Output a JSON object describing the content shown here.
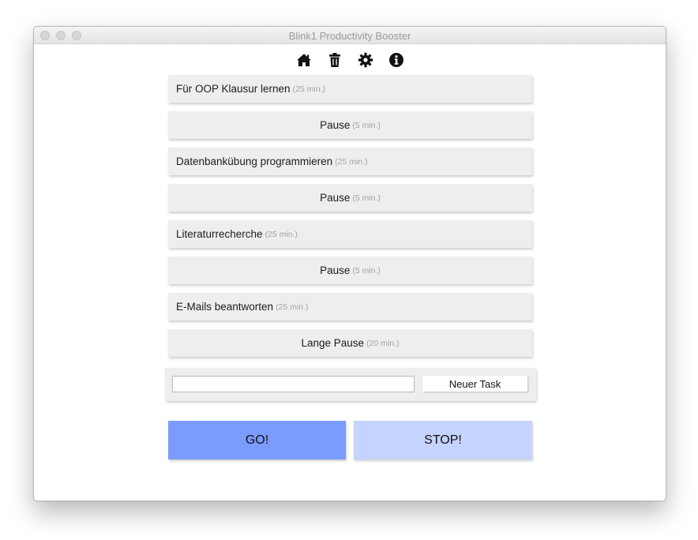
{
  "window": {
    "title": "Blink1 Productivity Booster"
  },
  "toolbar": {
    "icons": [
      "home-icon",
      "trash-icon",
      "gear-icon",
      "info-icon"
    ]
  },
  "tasks": [
    {
      "label": "Für OOP Klausur lernen",
      "duration": "(25 min.)",
      "type": "task"
    },
    {
      "label": "Pause",
      "duration": "(5 min.)",
      "type": "pause"
    },
    {
      "label": "Datenbankübung programmieren",
      "duration": "(25 min.)",
      "type": "task"
    },
    {
      "label": "Pause",
      "duration": "(5 min.)",
      "type": "pause"
    },
    {
      "label": "Literaturrecherche",
      "duration": "(25 min.)",
      "type": "task"
    },
    {
      "label": "Pause",
      "duration": "(5 min.)",
      "type": "pause"
    },
    {
      "label": "E-Mails beantworten",
      "duration": "(25 min.)",
      "type": "task"
    },
    {
      "label": "Lange Pause",
      "duration": "(20 min.)",
      "type": "pause"
    }
  ],
  "new_task": {
    "input_value": "",
    "button_label": "Neuer Task"
  },
  "controls": {
    "go_label": "GO!",
    "stop_label": "STOP!"
  },
  "colors": {
    "go": "#7b9bff",
    "stop": "#c5d3ff",
    "task_bg": "#eeeeee",
    "duration_text": "#a3a3a3"
  }
}
